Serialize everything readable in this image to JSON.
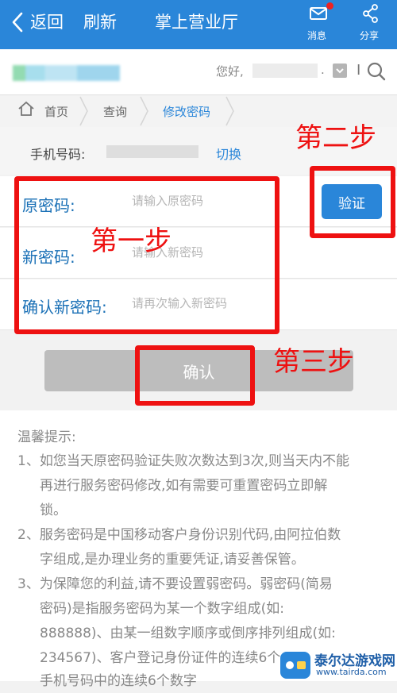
{
  "topbar": {
    "back_label": "返回",
    "refresh_label": "刷新",
    "title": "掌上营业厅",
    "messages_label": "消息",
    "share_label": "分享",
    "bg_color": "#2a86d9",
    "icons": [
      "chevron-left-icon",
      "envelope-icon",
      "share-icon"
    ]
  },
  "account": {
    "greeting": "您好,",
    "separator": ".",
    "pipe": "I"
  },
  "breadcrumb": {
    "items": [
      "首页",
      "查询",
      "修改密码"
    ]
  },
  "phone": {
    "label": "手机号码:",
    "switch_label": "切换"
  },
  "form": {
    "old_password": {
      "label": "原密码:",
      "placeholder": "请输入原密码"
    },
    "new_password": {
      "label": "新密码:",
      "placeholder": "请输入新密码"
    },
    "confirm_password": {
      "label": "确认新密码:",
      "placeholder": "请再次输入新密码"
    },
    "verify_label": "验证",
    "confirm_label": "确认"
  },
  "tips": {
    "heading": "温馨提示:",
    "lines": [
      "1、如您当天原密码验证失败次数达到3次,则当天内不能",
      "再进行服务密码修改,如有需要可重置密码立即解",
      "锁。",
      "2、服务密码是中国移动客户身份识别代码,由阿拉伯数",
      "字组成,是办理业务的重要凭证,请妥善保管。",
      "3、为保障您的利益,请不要设置弱密码。弱密码(简易",
      "密码)是指服务密码为某一个数字组成(如:",
      "888888)、由某一组数字顺序或倒序排列组成(如:",
      "234567)、客户登记身份证件的连续6个",
      "手机号码中的连续6个数字"
    ]
  },
  "annotations": {
    "step1": "第一步",
    "step2": "第二步",
    "step3": "第三步",
    "color": "#e11111"
  },
  "watermark": {
    "name": "泰尔达游戏网",
    "url": "www.tairda.com"
  }
}
